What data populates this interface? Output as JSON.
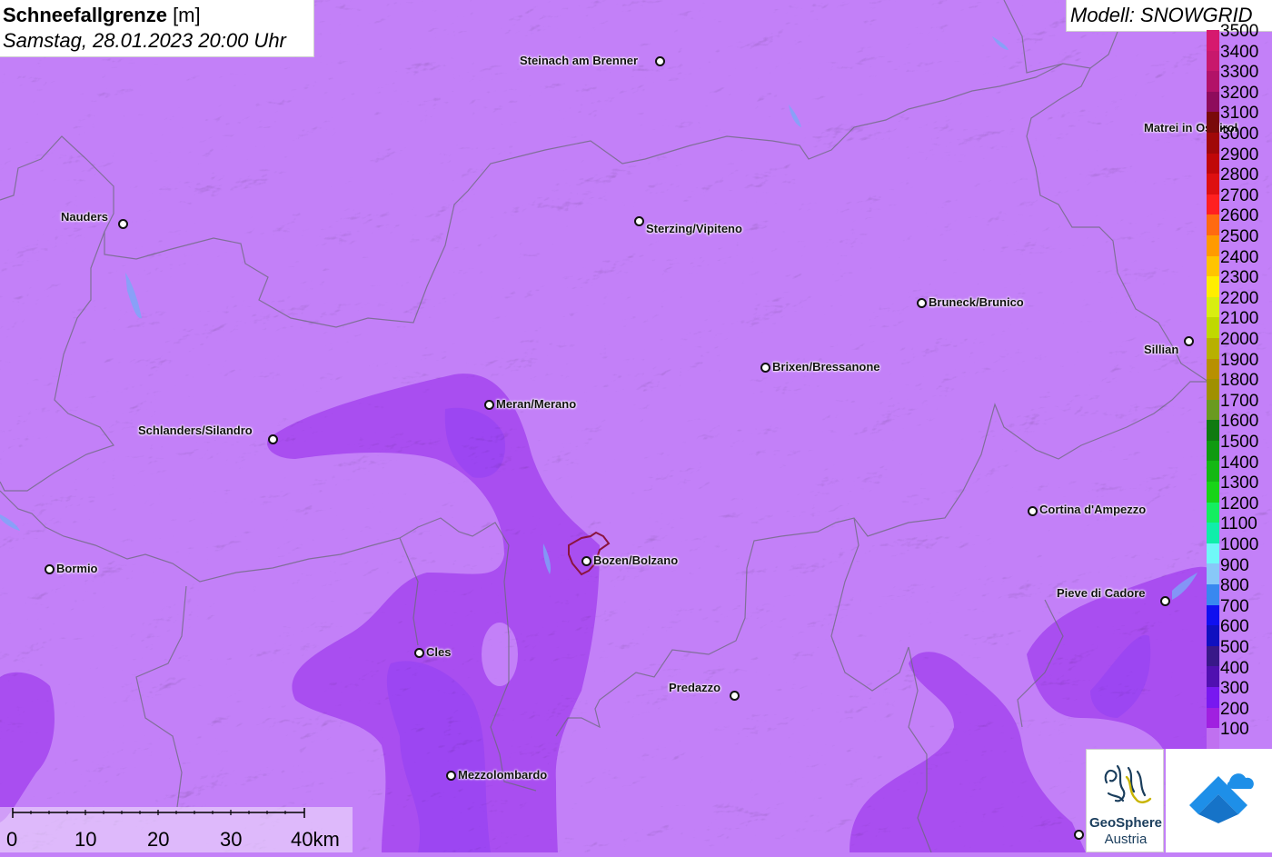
{
  "title": {
    "main_bold": "Schneefallgrenze",
    "main_unit": " [m]",
    "subtitle": "Samstag, 28.01.2023 20:00 Uhr"
  },
  "model": {
    "label": "Modell: SNOWGRID"
  },
  "places": [
    {
      "name": "Steinach am Brenner"
    },
    {
      "name": "Nauders"
    },
    {
      "name": "Sterzing/Vipiteno"
    },
    {
      "name": "Matrei in Osttirol"
    },
    {
      "name": "Bruneck/Brunico"
    },
    {
      "name": "Sillian"
    },
    {
      "name": "Brixen/Bressanone"
    },
    {
      "name": "Meran/Merano"
    },
    {
      "name": "Schlanders/Silandro"
    },
    {
      "name": "Cortina d'Ampezzo"
    },
    {
      "name": "Bormio"
    },
    {
      "name": "Bozen/Bolzano"
    },
    {
      "name": "Pieve di Cadore"
    },
    {
      "name": "Cles"
    },
    {
      "name": "Predazzo"
    },
    {
      "name": "Mezzolombardo"
    }
  ],
  "legend": {
    "levels": [
      {
        "value": "3500",
        "color": "#d6196e"
      },
      {
        "value": "3400",
        "color": "#c8186c"
      },
      {
        "value": "3300",
        "color": "#b21268"
      },
      {
        "value": "3200",
        "color": "#8e0c5c"
      },
      {
        "value": "3100",
        "color": "#7a0a0a"
      },
      {
        "value": "3000",
        "color": "#a00808"
      },
      {
        "value": "2900",
        "color": "#c00808"
      },
      {
        "value": "2800",
        "color": "#de1010"
      },
      {
        "value": "2700",
        "color": "#ff2020"
      },
      {
        "value": "2600",
        "color": "#ff6a10"
      },
      {
        "value": "2500",
        "color": "#ff9a00"
      },
      {
        "value": "2400",
        "color": "#ffc400"
      },
      {
        "value": "2300",
        "color": "#ffee00"
      },
      {
        "value": "2200",
        "color": "#d8ee10"
      },
      {
        "value": "2100",
        "color": "#c0d800"
      },
      {
        "value": "2000",
        "color": "#b8b000"
      },
      {
        "value": "1900",
        "color": "#b89000"
      },
      {
        "value": "1800",
        "color": "#a09000"
      },
      {
        "value": "1700",
        "color": "#6a9a20"
      },
      {
        "value": "1600",
        "color": "#107a10"
      },
      {
        "value": "1500",
        "color": "#109a10"
      },
      {
        "value": "1400",
        "color": "#14b814"
      },
      {
        "value": "1300",
        "color": "#18d418"
      },
      {
        "value": "1200",
        "color": "#14ee60"
      },
      {
        "value": "1100",
        "color": "#10eeaa"
      },
      {
        "value": "1000",
        "color": "#70f8f8"
      },
      {
        "value": "900",
        "color": "#88c8f8"
      },
      {
        "value": "800",
        "color": "#3888f0"
      },
      {
        "value": "700",
        "color": "#1010f0"
      },
      {
        "value": "600",
        "color": "#1010c0"
      },
      {
        "value": "500",
        "color": "#381888"
      },
      {
        "value": "400",
        "color": "#5010b0"
      },
      {
        "value": "300",
        "color": "#7818f0"
      },
      {
        "value": "200",
        "color": "#a020e0"
      },
      {
        "value": "100",
        "color": "#c070f0"
      }
    ]
  },
  "scale": {
    "ticks": [
      "0",
      "10",
      "20",
      "30",
      "40km"
    ]
  },
  "logo": {
    "line1": "GeoSphere",
    "line2": "Austria"
  }
}
